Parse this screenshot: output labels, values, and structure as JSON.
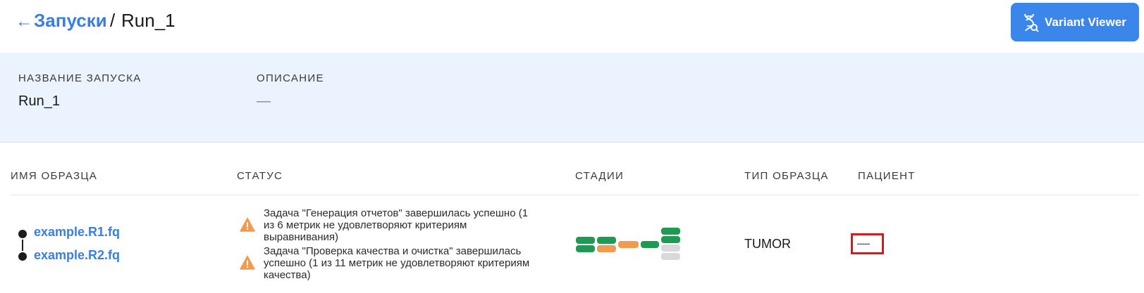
{
  "breadcrumb": {
    "back_icon": "arrow-left-icon",
    "parent": "Запуски",
    "separator": "/",
    "current": "Run_1"
  },
  "variant_viewer_button": {
    "label": "Variant Viewer",
    "icon": "dna-icon",
    "color": "#3b86ea"
  },
  "run_info": {
    "name_label": "НАЗВАНИЕ ЗАПУСКА",
    "name_value": "Run_1",
    "description_label": "ОПИСАНИЕ",
    "description_value": "—"
  },
  "table": {
    "headers": [
      "ИМЯ ОБРАЗЦА",
      "СТАТУС",
      "СТАДИИ",
      "ТИП ОБРАЗЦА",
      "ПАЦИЕНТ"
    ],
    "rows": [
      {
        "files": [
          "example.R1.fq",
          "example.R2.fq"
        ],
        "statuses": [
          {
            "icon": "warning-icon",
            "lines": [
              "Задача \"Генерация отчетов\" завершилась успешно (1",
              "из 6 метрик не удовлетворяют критериям",
              "выравнивания)"
            ]
          },
          {
            "icon": "warning-icon",
            "lines": [
              "Задача \"Проверка качества и очистка\" завершилась",
              "успешно (1 из 11 метрик не удовлетворяют критериям",
              "качества)"
            ]
          }
        ],
        "stages": {
          "colors": {
            "success": "#1e9a52",
            "warning": "#f29a4e",
            "pending": "#d9d9d9"
          },
          "columns": [
            [
              "success",
              "success"
            ],
            [
              "success",
              "warning"
            ],
            [
              "warning"
            ],
            [
              "success"
            ],
            [
              "success",
              "success",
              "pending",
              "pending"
            ]
          ]
        },
        "sample_type": "TUMOR",
        "patient": "—"
      }
    ]
  }
}
